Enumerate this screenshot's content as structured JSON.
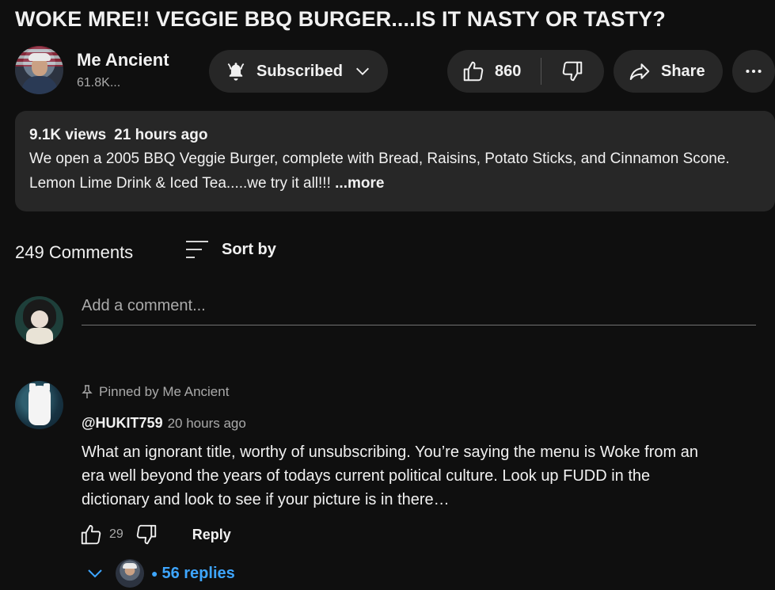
{
  "video": {
    "title": "WOKE MRE!! VEGGIE BBQ BURGER....IS IT NASTY OR TASTY?"
  },
  "channel": {
    "name": "Me Ancient",
    "subscribers": "61.8K..."
  },
  "actions": {
    "subscribed_label": "Subscribed",
    "like_count": "860",
    "share_label": "Share"
  },
  "description": {
    "views": "9.1K views",
    "age": "21 hours ago",
    "text": "We open a 2005 BBQ Veggie Burger, complete with Bread, Raisins, Potato Sticks, and Cinnamon Scone.  Lemon Lime Drink & Iced Tea.....we try it all!!! ",
    "more_label": "...more"
  },
  "comments": {
    "count_label": "249 Comments",
    "sort_label": "Sort by",
    "add_placeholder": "Add a comment...",
    "items": [
      {
        "pinned_label": "Pinned by Me Ancient",
        "author": "@HUKIT759",
        "time": "20 hours ago",
        "text": "What an ignorant title, worthy of unsubscribing. You’re saying the menu is Woke from an era well beyond the years of todays current political culture. Look up FUDD in the dictionary and look to see if your picture is in there…",
        "likes": "29",
        "reply_label": "Reply",
        "replies_label": "56 replies"
      }
    ]
  },
  "icons": {
    "bell": "bell-icon",
    "chevron": "chevron-down-icon",
    "like": "thumbs-up-icon",
    "dislike": "thumbs-down-icon",
    "share": "share-arrow-icon",
    "more": "more-horizontal-icon",
    "sort": "sort-icon",
    "pin": "pin-icon"
  },
  "colors": {
    "background": "#0f0f0f",
    "surface": "#272727",
    "text": "#f1f1f1",
    "muted": "#aaaaaa",
    "link": "#3ea6ff"
  }
}
